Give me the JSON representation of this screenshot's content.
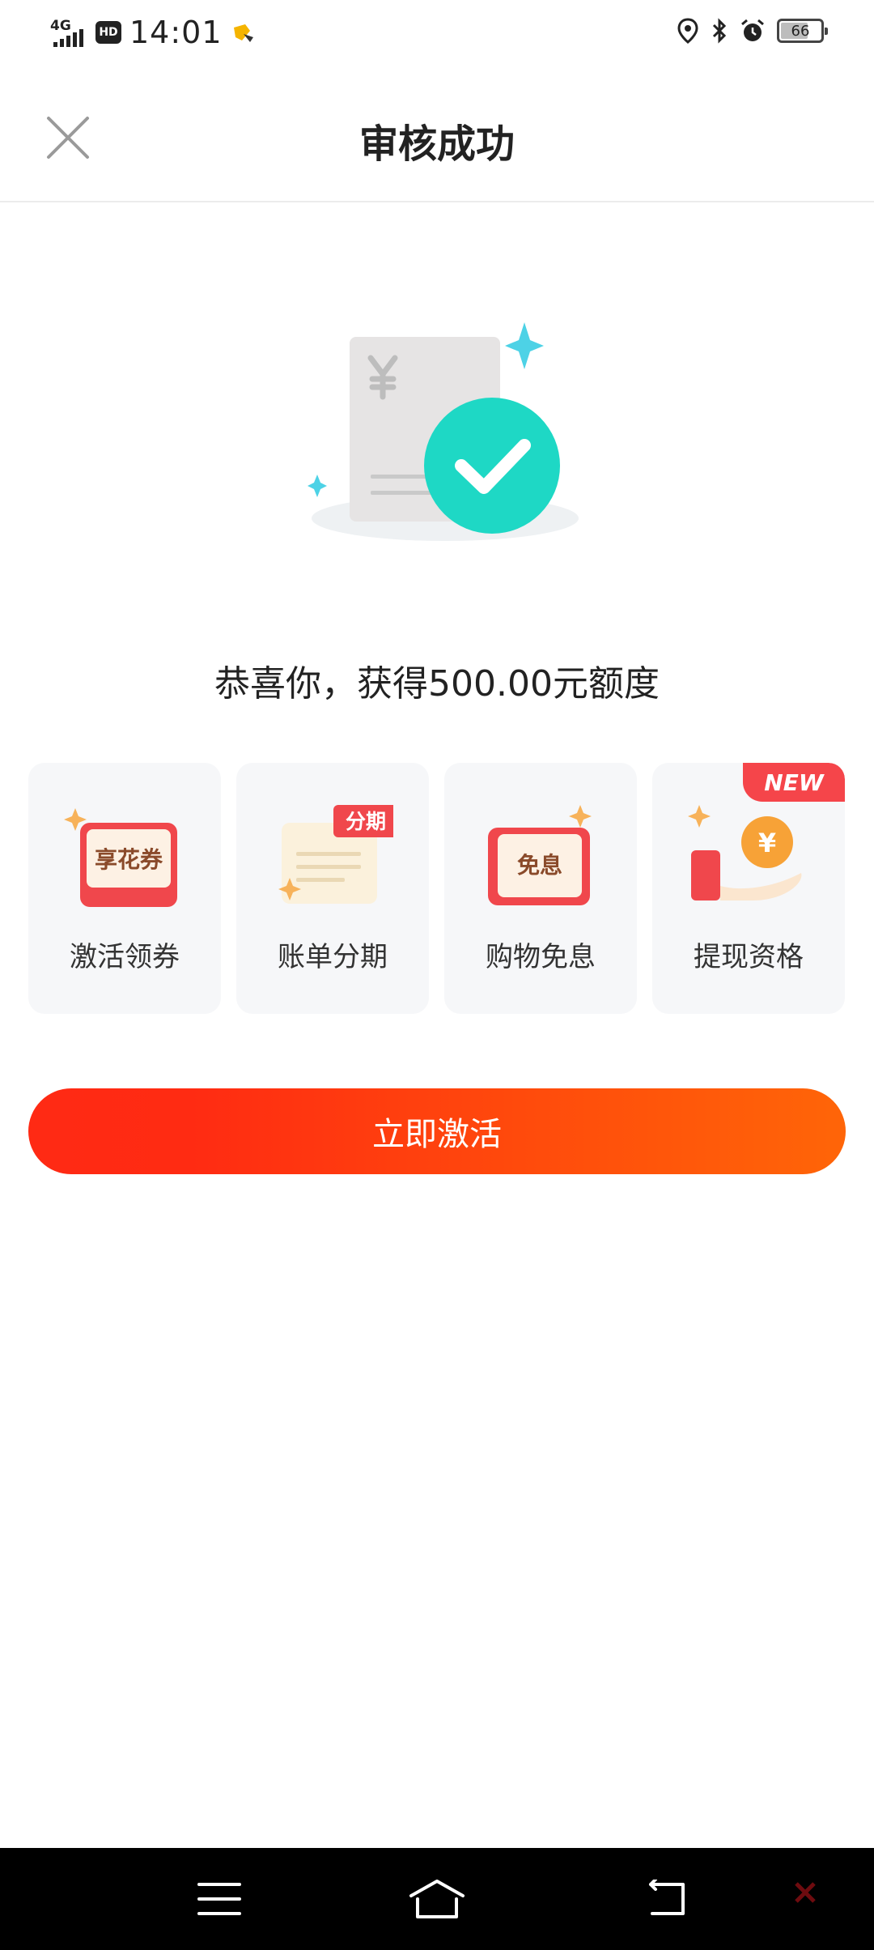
{
  "status_bar": {
    "network": "4G",
    "hd": "HD",
    "time": "14:01",
    "battery": "66"
  },
  "header": {
    "title": "审核成功"
  },
  "result": {
    "message": "恭喜你，获得500.00元额度"
  },
  "benefits": [
    {
      "label": "激活领券",
      "icon_text": "享花券"
    },
    {
      "label": "账单分期",
      "icon_text": "分期"
    },
    {
      "label": "购物免息",
      "icon_text": "免息"
    },
    {
      "label": "提现资格",
      "badge": "NEW"
    }
  ],
  "actions": {
    "activate_label": "立即激活"
  },
  "colors": {
    "primary": "#ff2a14",
    "primary_end": "#ff6508",
    "success": "#1fd9c0",
    "card_bg": "#f6f7f9"
  }
}
